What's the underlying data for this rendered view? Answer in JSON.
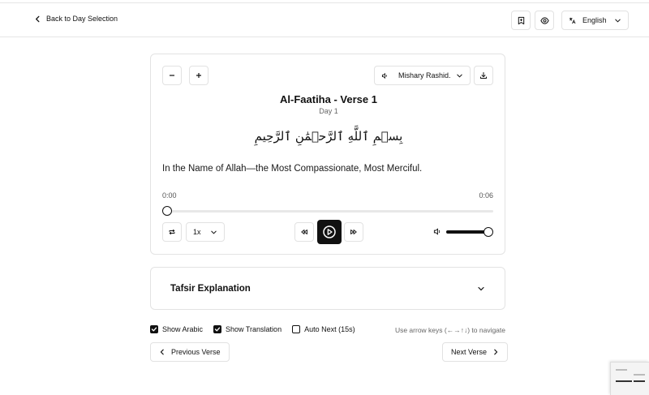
{
  "header": {
    "back_label": "Back to Day Selection",
    "language": "English"
  },
  "player": {
    "reciter": "Mishary Rashid...",
    "verse_title": "Al-Faatiha - Verse 1",
    "day_label": "Day 1",
    "arabic_text": "بِسۡمِ ٱللَّهِ ٱلرَّحۡمَٰنِ ٱلرَّحِيمِ",
    "translation": "In the Name of Allah—the Most Compassionate, Most Merciful.",
    "current_time": "0:00",
    "duration": "0:06",
    "progress": 0,
    "speed": "1x",
    "volume": 1.0
  },
  "tafsir": {
    "title": "Tafsir Explanation"
  },
  "options": {
    "show_arabic": {
      "label": "Show Arabic",
      "checked": true
    },
    "show_translation": {
      "label": "Show Translation",
      "checked": true
    },
    "auto_next": {
      "label": "Auto Next (15s)",
      "checked": false
    },
    "hint": "Use arrow keys (←→↑↓) to navigate"
  },
  "navigation": {
    "previous": "Previous Verse",
    "next": "Next Verse"
  },
  "colors": {
    "accent": "#111111",
    "border": "#e3e3e3",
    "muted_text": "#666666"
  }
}
